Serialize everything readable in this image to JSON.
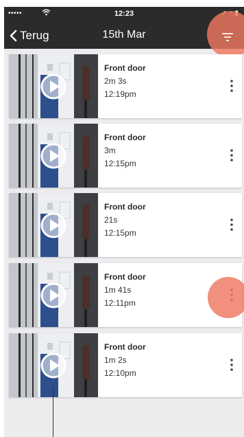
{
  "status_bar": {
    "signal": "•••••",
    "time": "12:23",
    "right_icons": "➚ ◔ ▮"
  },
  "nav": {
    "back_label": "Terug",
    "title": "15th Mar"
  },
  "colors": {
    "topbar": "#2b2b2b",
    "accent": "#ee7860",
    "background": "#ececef"
  },
  "icons": {
    "back": "chevron-left-icon",
    "filter": "filter-icon",
    "more": "more-vertical-icon",
    "play": "play-icon"
  },
  "recordings": [
    {
      "title": "Front door",
      "duration": "2m 3s",
      "time": "12:19pm"
    },
    {
      "title": "Front door",
      "duration": "3m",
      "time": "12:15pm"
    },
    {
      "title": "Front door",
      "duration": "21s",
      "time": "12:15pm"
    },
    {
      "title": "Front door",
      "duration": "1m 41s",
      "time": "12:11pm"
    },
    {
      "title": "Front door",
      "duration": "1m 2s",
      "time": "12:10pm"
    }
  ]
}
